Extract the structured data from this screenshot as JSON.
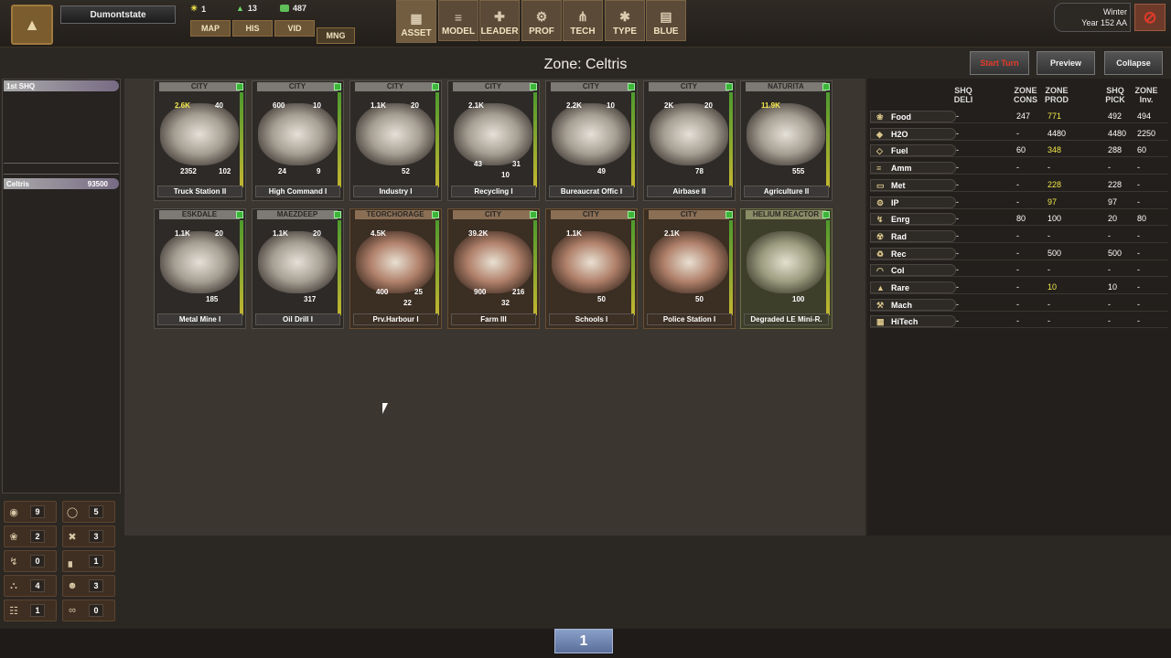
{
  "header": {
    "nation_name": "Dumontstate",
    "resources": [
      {
        "icon": "sun-icon",
        "value": "1"
      },
      {
        "icon": "beaker-icon",
        "value": "13"
      },
      {
        "icon": "cash-icon",
        "value": "487"
      }
    ],
    "sub_tabs": [
      "MAP",
      "HIS",
      "VID",
      "MNG"
    ],
    "nav_tabs": [
      {
        "label": "ASSET",
        "icon": "building-icon"
      },
      {
        "label": "MODEL",
        "icon": "sliders-icon"
      },
      {
        "label": "LEADER",
        "icon": "strongman-icon"
      },
      {
        "label": "PROF",
        "icon": "gears-icon"
      },
      {
        "label": "TECH",
        "icon": "tree-icon"
      },
      {
        "label": "TYPE",
        "icon": "runner-icon"
      },
      {
        "label": "BLUE",
        "icon": "document-icon"
      }
    ],
    "season": "Winter",
    "year": "Year 152 AA"
  },
  "zone_title": "Zone: Celtris",
  "buttons": {
    "start_turn": "Start Turn",
    "preview": "Preview",
    "collapse": "Collapse"
  },
  "left": {
    "groups": [
      {
        "name": "1st SHQ",
        "value": ""
      },
      {
        "name": "Celtris",
        "value": "93500"
      }
    ],
    "stats": [
      {
        "icon": "helmet-icon",
        "value": "9"
      },
      {
        "icon": "shield-icon",
        "value": "5"
      },
      {
        "icon": "wheat-icon",
        "value": "2"
      },
      {
        "icon": "crossed-swords-icon",
        "value": "3"
      },
      {
        "icon": "lightning-icon",
        "value": "0"
      },
      {
        "icon": "factory-icon",
        "value": "1"
      },
      {
        "icon": "bank-icon",
        "value": "4"
      },
      {
        "icon": "people-icon",
        "value": "3"
      },
      {
        "icon": "hierarchy-icon",
        "value": "1"
      },
      {
        "icon": "link-icon",
        "value": "0"
      }
    ]
  },
  "cards": [
    {
      "type": "CITY",
      "name": "Truck Station II",
      "v1": "2.6K",
      "v1y": true,
      "v2": "40",
      "b1": "2352",
      "b2": "102"
    },
    {
      "type": "CITY",
      "name": "High Command I",
      "v1": "600",
      "v2": "10",
      "b1": "24",
      "b2": "9"
    },
    {
      "type": "CITY",
      "name": "Industry I",
      "v1": "1.1K",
      "v2": "20",
      "b1": "52",
      "b2": ""
    },
    {
      "type": "CITY",
      "name": "Recycling I",
      "v1": "2.1K",
      "v2": "",
      "b1": "43",
      "b2": "31",
      "b3": "10"
    },
    {
      "type": "CITY",
      "name": "Bureaucrat Offic I",
      "v1": "2.2K",
      "v2": "10",
      "b1": "49",
      "b2": ""
    },
    {
      "type": "CITY",
      "name": "Airbase II",
      "v1": "2K",
      "v2": "20",
      "b1": "78",
      "b2": ""
    },
    {
      "type": "NATURITA",
      "name": "Agriculture II",
      "v1": "11.9K",
      "v1y": true,
      "v2": "",
      "b1": "555",
      "b2": ""
    },
    {
      "type": "ESKDALE",
      "name": "Metal Mine I",
      "v1": "1.1K",
      "v2": "20",
      "b1": "185",
      "b2": ""
    },
    {
      "type": "MAEZDEEP",
      "name": "Oil Drill I",
      "v1": "1.1K",
      "v2": "20",
      "b1": "317",
      "b2": ""
    },
    {
      "type": "TEORCHORAGE",
      "name": "Prv.Harbour I",
      "v1": "4.5K",
      "v2": "",
      "b1": "400",
      "b2": "25",
      "b3": "22"
    },
    {
      "type": "CITY",
      "name": "Farm III",
      "v1": "39.2K",
      "v2": "",
      "b1": "900",
      "b2": "216",
      "b3": "32"
    },
    {
      "type": "CITY",
      "name": "Schools I",
      "v1": "1.1K",
      "v2": "",
      "b1": "50",
      "b2": ""
    },
    {
      "type": "CITY",
      "name": "Police Station I",
      "v1": "2.1K",
      "v2": "",
      "b1": "50",
      "b2": ""
    },
    {
      "type": "HELIUM REACTOR",
      "name": "Degraded LE Mini-R.",
      "v1": "",
      "v2": "",
      "b1": "100",
      "b2": ""
    }
  ],
  "table": {
    "headers": [
      [
        "SHQ",
        "DELI"
      ],
      [
        "ZONE",
        "CONS"
      ],
      [
        "ZONE",
        "PROD"
      ],
      [
        "SHQ",
        "PICK"
      ],
      [
        "ZONE",
        "Inv."
      ]
    ],
    "rows": [
      {
        "label": "Food",
        "icon": "wheat-icon",
        "c": [
          "-",
          "247",
          "771",
          "492",
          "494"
        ],
        "y": [
          false,
          false,
          true,
          false,
          false
        ]
      },
      {
        "label": "H2O",
        "icon": "water-drop-icon",
        "c": [
          "-",
          "-",
          "4480",
          "4480",
          "2250"
        ],
        "y": [
          false,
          false,
          false,
          false,
          false
        ]
      },
      {
        "label": "Fuel",
        "icon": "fuel-drop-icon",
        "c": [
          "-",
          "60",
          "348",
          "288",
          "60"
        ],
        "y": [
          false,
          false,
          true,
          false,
          false
        ]
      },
      {
        "label": "Amm",
        "icon": "ammo-icon",
        "c": [
          "-",
          "-",
          "-",
          "-",
          "-"
        ],
        "y": [
          false,
          false,
          false,
          false,
          false
        ]
      },
      {
        "label": "Met",
        "icon": "metal-icon",
        "c": [
          "-",
          "-",
          "228",
          "228",
          "-"
        ],
        "y": [
          false,
          false,
          true,
          false,
          false
        ]
      },
      {
        "label": "IP",
        "icon": "gear-icon",
        "c": [
          "-",
          "-",
          "97",
          "97",
          "-"
        ],
        "y": [
          false,
          false,
          true,
          false,
          false
        ]
      },
      {
        "label": "Enrg",
        "icon": "lightning-icon",
        "c": [
          "-",
          "80",
          "100",
          "20",
          "80"
        ],
        "y": [
          false,
          false,
          false,
          false,
          false
        ]
      },
      {
        "label": "Rad",
        "icon": "radiation-icon",
        "c": [
          "-",
          "-",
          "-",
          "-",
          "-"
        ],
        "y": [
          false,
          false,
          false,
          false,
          false
        ]
      },
      {
        "label": "Rec",
        "icon": "recycle-icon",
        "c": [
          "-",
          "-",
          "500",
          "500",
          "-"
        ],
        "y": [
          false,
          false,
          false,
          false,
          false
        ]
      },
      {
        "label": "Col",
        "icon": "dome-icon",
        "c": [
          "-",
          "-",
          "-",
          "-",
          "-"
        ],
        "y": [
          false,
          false,
          false,
          false,
          false
        ]
      },
      {
        "label": "Rare",
        "icon": "rare-icon",
        "c": [
          "-",
          "-",
          "10",
          "10",
          "-"
        ],
        "y": [
          false,
          false,
          true,
          false,
          false
        ]
      },
      {
        "label": "Mach",
        "icon": "machine-icon",
        "c": [
          "-",
          "-",
          "-",
          "-",
          "-"
        ],
        "y": [
          false,
          false,
          false,
          false,
          false
        ]
      },
      {
        "label": "HiTech",
        "icon": "chip-icon",
        "c": [
          "-",
          "-",
          "-",
          "-",
          "-"
        ],
        "y": [
          false,
          false,
          false,
          false,
          false
        ]
      }
    ]
  },
  "page": "1"
}
